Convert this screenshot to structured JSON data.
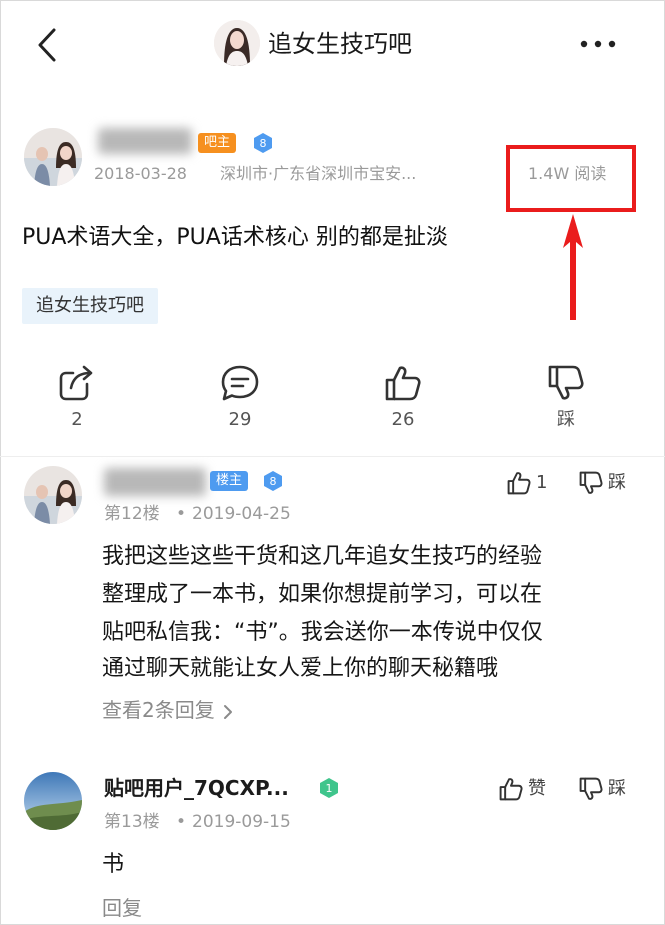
{
  "header": {
    "title": "追女生技巧吧",
    "back_icon": "chevron-left-icon",
    "more_icon": "more-dots-icon"
  },
  "post": {
    "author_badge": "吧主",
    "author_level": "8",
    "date": "2018-03-28",
    "location": "深圳市·广东省深圳市宝安...",
    "read_count": "1.4W 阅读",
    "title": "PUA术语大全，PUA话术核心 别的都是扯淡",
    "forum_tag": "追女生技巧吧",
    "actions": {
      "share": "2",
      "comment": "29",
      "like": "26",
      "dislike": "踩"
    }
  },
  "comments": [
    {
      "badge": "楼主",
      "level": "8",
      "floor": "第12楼",
      "date": "2019-04-25",
      "like_count": "1",
      "dislike_label": "踩",
      "text_lines": [
        "我把这些这些干货和这几年追女生技巧的经验",
        "整理成了一本书，如果你想提前学习，可以在",
        "贴吧私信我：“书”。我会送你一本传说中仅仅",
        "通过聊天就能让女人爱上你的聊天秘籍哦"
      ],
      "replies_link": "查看2条回复"
    },
    {
      "user_name": "贴吧用户_7QCXP...",
      "level": "1",
      "floor": "第13楼",
      "date": "2019-09-15",
      "like_label": "赞",
      "dislike_label": "踩",
      "text": "书",
      "reply_label": "回复"
    }
  ],
  "colors": {
    "highlight_red": "#ea1c1c",
    "badge_orange": "#f6901f",
    "badge_blue": "#4e9bf0",
    "level_green": "#3fc58c",
    "tag_bg": "#e9f3fb"
  }
}
